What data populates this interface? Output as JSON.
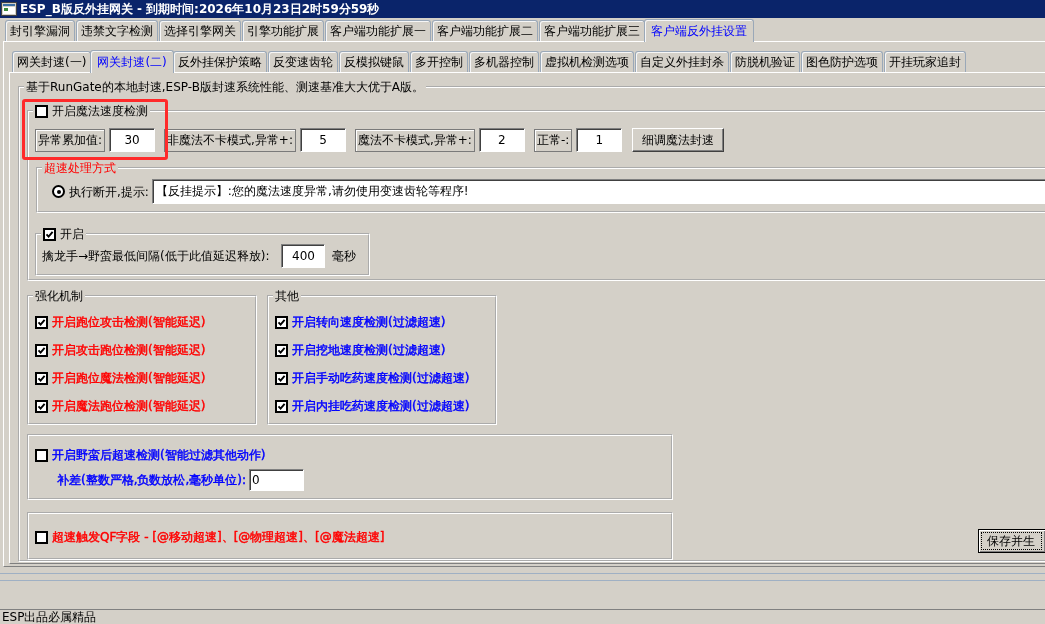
{
  "window": {
    "title": "ESP_B版反外挂网关 - 到期时间:2026年10月23日2时59分59秒"
  },
  "main_tabs": [
    {
      "label": "封引擎漏洞",
      "selected": false
    },
    {
      "label": "违禁文字检测",
      "selected": false
    },
    {
      "label": "选择引擎网关",
      "selected": false
    },
    {
      "label": "引擎功能扩展",
      "selected": false
    },
    {
      "label": "客户端功能扩展一",
      "selected": false
    },
    {
      "label": "客户端功能扩展二",
      "selected": false
    },
    {
      "label": "客户端功能扩展三",
      "selected": false
    },
    {
      "label": "客户端反外挂设置",
      "selected": true
    }
  ],
  "sub_tabs": [
    {
      "label": "网关封速(一)",
      "selected": false
    },
    {
      "label": "网关封速(二)",
      "selected": true
    },
    {
      "label": "反外挂保护策略",
      "selected": false
    },
    {
      "label": "反变速齿轮",
      "selected": false
    },
    {
      "label": "反模拟键鼠",
      "selected": false
    },
    {
      "label": "多开控制",
      "selected": false
    },
    {
      "label": "多机器控制",
      "selected": false
    },
    {
      "label": "虚拟机检测选项",
      "selected": false
    },
    {
      "label": "自定义外挂封杀",
      "selected": false
    },
    {
      "label": "防脱机验证",
      "selected": false
    },
    {
      "label": "图色防护选项",
      "selected": false
    },
    {
      "label": "开挂玩家追封",
      "selected": false
    }
  ],
  "speed_panel": {
    "caption": "基于RunGate的本地封速,ESP-B版封速系统性能、测速基准大大优于A版。",
    "magic_check": {
      "label": "开启魔法速度检测",
      "checked": false,
      "fields": [
        {
          "label": "异常累加值:",
          "value": "30"
        },
        {
          "label": "非魔法不卡模式,异常+:",
          "value": "5"
        },
        {
          "label": "魔法不卡模式,异常+:",
          "value": "2"
        },
        {
          "label": "正常-:",
          "value": "1"
        }
      ],
      "tune_button": "细调魔法封速",
      "handling": {
        "caption": "超速处理方式",
        "options": [
          {
            "label": "执行断开,提示:",
            "selected": true
          }
        ],
        "message": "【反挂提示】:您的魔法速度异常,请勿使用变速齿轮等程序!"
      },
      "interval": {
        "label": "开启",
        "checked": true,
        "field_label": "擒龙手→野蛮最低间隔(低于此值延迟释放):",
        "value": "400",
        "unit": "毫秒"
      }
    },
    "groups": [
      {
        "title": "强化机制",
        "items": [
          {
            "label": "开启跑位攻击检测(智能延迟)",
            "checked": true,
            "color": "#ff0000"
          },
          {
            "label": "开启攻击跑位检测(智能延迟)",
            "checked": true,
            "color": "#ff0000"
          },
          {
            "label": "开启跑位魔法检测(智能延迟)",
            "checked": true,
            "color": "#ff0000"
          },
          {
            "label": "开启魔法跑位检测(智能延迟)",
            "checked": true,
            "color": "#ff0000"
          }
        ]
      },
      {
        "title": "其他",
        "items": [
          {
            "label": "开启转向速度检测(过滤超速)",
            "checked": true,
            "color": "#0000ff"
          },
          {
            "label": "开启挖地速度检测(过滤超速)",
            "checked": true,
            "color": "#0000ff"
          },
          {
            "label": "开启手动吃药速度检测(过滤超速)",
            "checked": true,
            "color": "#0000ff"
          },
          {
            "label": "开启内挂吃药速度检测(过滤超速)",
            "checked": true,
            "color": "#0000ff"
          }
        ]
      }
    ],
    "extra_boxes": [
      {
        "kind": "input",
        "label": "开启野蛮后超速检测(智能过滤其他动作)",
        "checked": false,
        "color": "#0000ff",
        "field_label": "补差(整数严格,负数放松,毫秒单位):",
        "value": "0"
      },
      {
        "kind": "plain",
        "label": "超速触发QF字段 - [@移动超速]、[@物理超速]、[@魔法超速]",
        "checked": false,
        "color": "#ff0000"
      }
    ],
    "save_button": "保存并生"
  },
  "status_bar": "ESP出品必属精品",
  "annotations": [
    {
      "kind": "rectangle"
    }
  ]
}
